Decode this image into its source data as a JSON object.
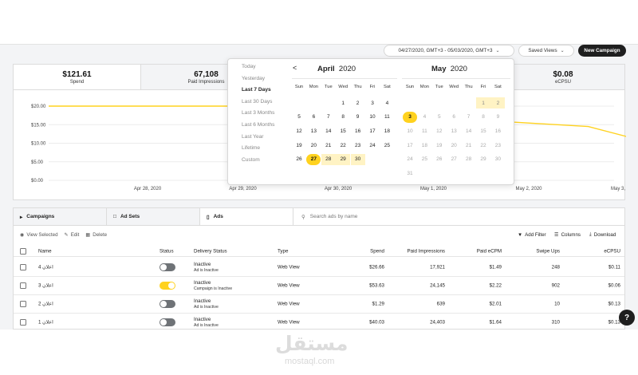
{
  "header": {
    "date_range": "04/27/2020, GMT+3 - 05/03/2020, GMT+3",
    "saved_views": "Saved Views",
    "new_campaign": "New Campaign"
  },
  "stats": [
    {
      "value": "$121.61",
      "label": "Spend"
    },
    {
      "value": "67,108",
      "label": "Paid Impressions"
    },
    {
      "value": "$0.08",
      "label": "eCPSU"
    }
  ],
  "chart_data": {
    "type": "line",
    "x": [
      "Apr 28, 2020",
      "Apr 29, 2020",
      "Apr 30, 2020",
      "May 1, 2020",
      "May 2, 2020",
      "May 3, 2020"
    ],
    "xticks": [
      "Apr 28, 2020",
      "Apr 29, 2020",
      "Apr 30, 2020",
      "May 1, 2020",
      "May 2, 2020",
      "May 3, 2020"
    ],
    "yticks": [
      "$20.00",
      "$15.00",
      "$10.00",
      "$5.00",
      "$0.00"
    ],
    "ylim": [
      0,
      20
    ],
    "series": [
      {
        "points": [
          [
            0,
            20.0
          ],
          [
            1.1,
            20.0
          ],
          [
            4.75,
            14.5
          ],
          [
            5.75,
            7.8
          ]
        ],
        "color": "#ffd21f"
      }
    ]
  },
  "picker": {
    "presets": [
      "Today",
      "Yesterday",
      "Last 7 Days",
      "Last 30 Days",
      "Last 3 Months",
      "Last 6 Months",
      "Last Year",
      "Lifetime",
      "Custom"
    ],
    "selected_preset": "Last 7 Days",
    "weekdays": [
      "Sun",
      "Mon",
      "Tue",
      "Wed",
      "Thu",
      "Fri",
      "Sat"
    ],
    "left_month": {
      "name": "April",
      "year": "2020"
    },
    "right_month": {
      "name": "May",
      "year": "2020"
    },
    "prev": "<",
    "april_days": [
      "1",
      "2",
      "3",
      "4",
      "5",
      "6",
      "7",
      "8",
      "9",
      "10",
      "11",
      "12",
      "13",
      "14",
      "15",
      "16",
      "17",
      "18",
      "19",
      "20",
      "21",
      "22",
      "23",
      "24",
      "25",
      "26",
      "27",
      "28",
      "29",
      "30"
    ],
    "may_days": [
      "1",
      "2",
      "3",
      "4",
      "5",
      "6",
      "7",
      "8",
      "9",
      "10",
      "11",
      "12",
      "13",
      "14",
      "15",
      "16",
      "17",
      "18",
      "19",
      "20",
      "21",
      "22",
      "23",
      "24",
      "25",
      "26",
      "27",
      "28",
      "29",
      "30",
      "31"
    ]
  },
  "table": {
    "tabs": [
      "Campaigns",
      "Ad Sets",
      "Ads"
    ],
    "search_placeholder": "Search ads by name",
    "actions": {
      "view": "View Selected",
      "edit": "Edit",
      "delete": "Delete",
      "filter": "Add Filter",
      "columns": "Columns",
      "download": "Download"
    },
    "headers": [
      "Name",
      "Status",
      "Delivery Status",
      "Type",
      "Spend",
      "Paid Impressions",
      "Paid eCPM",
      "Swipe Ups",
      "eCPSU"
    ],
    "rows": [
      {
        "name": "اعلان 4",
        "on": false,
        "delivery": "Inactive",
        "delivery_sub": "Ad is Inactive",
        "type": "Web View",
        "spend": "$26.66",
        "impressions": "17,921",
        "ecpm": "$1.49",
        "swipes": "248",
        "ecpsu": "$0.11"
      },
      {
        "name": "اعلان 3",
        "on": true,
        "delivery": "Inactive",
        "delivery_sub": "Campaign is Inactive",
        "type": "Web View",
        "spend": "$53.63",
        "impressions": "24,145",
        "ecpm": "$2.22",
        "swipes": "902",
        "ecpsu": "$0.06"
      },
      {
        "name": "اعلان 2",
        "on": false,
        "delivery": "Inactive",
        "delivery_sub": "Ad is Inactive",
        "type": "Web View",
        "spend": "$1.29",
        "impressions": "639",
        "ecpm": "$2.01",
        "swipes": "10",
        "ecpsu": "$0.13"
      },
      {
        "name": "اعلان 1",
        "on": false,
        "delivery": "Inactive",
        "delivery_sub": "Ad is Inactive",
        "type": "Web View",
        "spend": "$40.03",
        "impressions": "24,403",
        "ecpm": "$1.64",
        "swipes": "310",
        "ecpsu": "$0.13"
      }
    ]
  },
  "watermark": {
    "arabic": "مستقل",
    "latin": "mostaql.com"
  },
  "help": "?",
  "colors": {
    "accent": "#ffd21f",
    "range": "#fff3c4",
    "dark": "#1f1f1f"
  }
}
